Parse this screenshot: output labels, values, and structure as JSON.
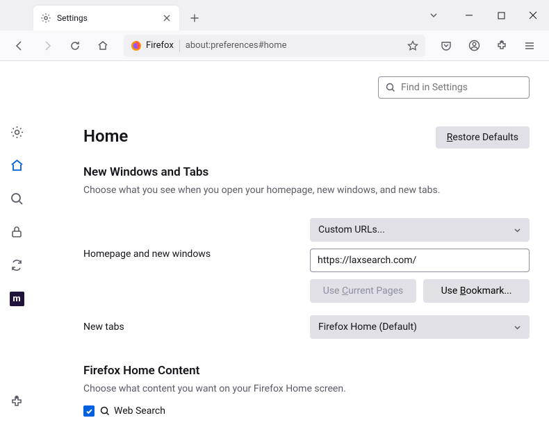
{
  "tab": {
    "title": "Settings"
  },
  "url": {
    "identity": "Firefox",
    "path": "about:preferences#home"
  },
  "search": {
    "placeholder": "Find in Settings"
  },
  "page": {
    "heading": "Home",
    "restore": "estore Defaults",
    "section1": {
      "title": "New Windows and Tabs",
      "desc": "Choose what you see when you open your homepage, new windows, and new tabs."
    },
    "homepage": {
      "label": "Homepage and new windows",
      "dropdown": "Custom URLs...",
      "input_value": "https://laxsearch.com/",
      "use_current": "urrent Pages",
      "use_bookmark": "ookmark..."
    },
    "newtabs": {
      "label": "New tabs",
      "dropdown": "Firefox Home (Default)"
    },
    "section2": {
      "title": "Firefox Home Content",
      "desc": "Choose what content you want on your Firefox Home screen.",
      "websearch": "Web Search"
    }
  }
}
